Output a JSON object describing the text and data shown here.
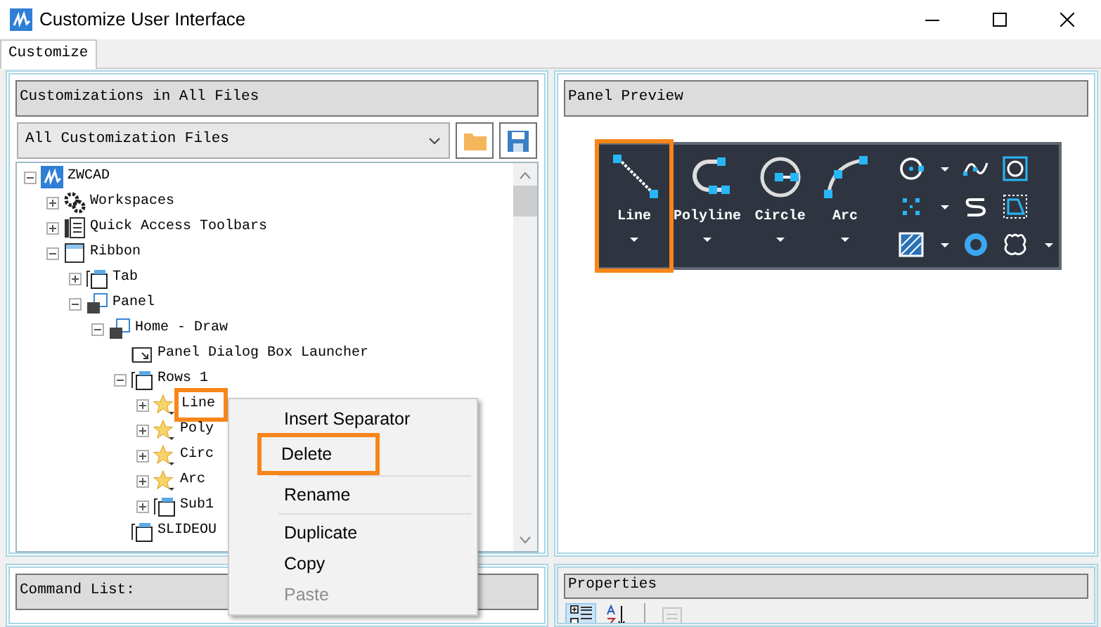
{
  "window": {
    "title": "Customize User Interface"
  },
  "tabs": [
    {
      "label": "Customize",
      "selected": true
    }
  ],
  "customizations_panel": {
    "title": "Customizations in All Files",
    "file_dropdown": {
      "value": "All Customization Files"
    },
    "tree": [
      {
        "label": "ZWCAD",
        "kind": "root",
        "expanded": true,
        "children": [
          {
            "label": "Workspaces",
            "kind": "workspaces",
            "expanded": false
          },
          {
            "label": "Quick Access Toolbars",
            "kind": "toolbars",
            "expanded": false
          },
          {
            "label": "Ribbon",
            "kind": "ribbon",
            "expanded": true,
            "children": [
              {
                "label": "Tab",
                "kind": "tabs",
                "expanded": false
              },
              {
                "label": "Panel",
                "kind": "panel",
                "expanded": true,
                "children": [
                  {
                    "label": "Home - Draw",
                    "kind": "panel",
                    "expanded": true,
                    "children": [
                      {
                        "label": "Panel Dialog Box Launcher",
                        "kind": "launcher"
                      },
                      {
                        "label": "Rows 1",
                        "kind": "row",
                        "expanded": true,
                        "children": [
                          {
                            "label": "Line",
                            "kind": "command",
                            "expanded": false,
                            "highlighted": true
                          },
                          {
                            "label": "Poly",
                            "kind": "command",
                            "expanded": false,
                            "highlighted": false
                          },
                          {
                            "label": "Circ",
                            "kind": "command",
                            "expanded": false,
                            "highlighted": false
                          },
                          {
                            "label": "Arc",
                            "kind": "command",
                            "expanded": false,
                            "highlighted": false
                          },
                          {
                            "label": "Sub1",
                            "kind": "row",
                            "expanded": false,
                            "highlighted": false
                          }
                        ]
                      },
                      {
                        "label": "SLIDEOU",
                        "kind": "row"
                      }
                    ]
                  }
                ]
              }
            ]
          }
        ]
      }
    ]
  },
  "context_menu": [
    {
      "kind": "item",
      "label": "Insert Separator",
      "disabled": false,
      "highlighted": false
    },
    {
      "kind": "item",
      "label": "Delete",
      "disabled": false,
      "highlighted": true
    },
    {
      "kind": "separator"
    },
    {
      "kind": "item",
      "label": "Rename",
      "disabled": false,
      "highlighted": false
    },
    {
      "kind": "separator"
    },
    {
      "kind": "item",
      "label": "Duplicate",
      "disabled": false,
      "highlighted": false
    },
    {
      "kind": "item",
      "label": "Copy",
      "disabled": false,
      "highlighted": false
    },
    {
      "kind": "item",
      "label": "Paste",
      "disabled": true,
      "highlighted": false
    }
  ],
  "panel_preview": {
    "title": "Panel Preview",
    "large_buttons": [
      {
        "label": "Line",
        "kind": "line",
        "highlighted": true
      },
      {
        "label": "Polyline",
        "kind": "polyline",
        "highlighted": false
      },
      {
        "label": "Circle",
        "kind": "circle",
        "highlighted": false
      },
      {
        "label": "Arc",
        "kind": "arc",
        "highlighted": false
      }
    ]
  },
  "command_list": {
    "title": "Command List:"
  },
  "properties": {
    "title": "Properties",
    "toolbar": [
      {
        "kind": "categorized",
        "selected": true
      },
      {
        "kind": "alphabetical",
        "selected": false
      },
      {
        "kind": "pages",
        "disabled": true
      }
    ]
  }
}
